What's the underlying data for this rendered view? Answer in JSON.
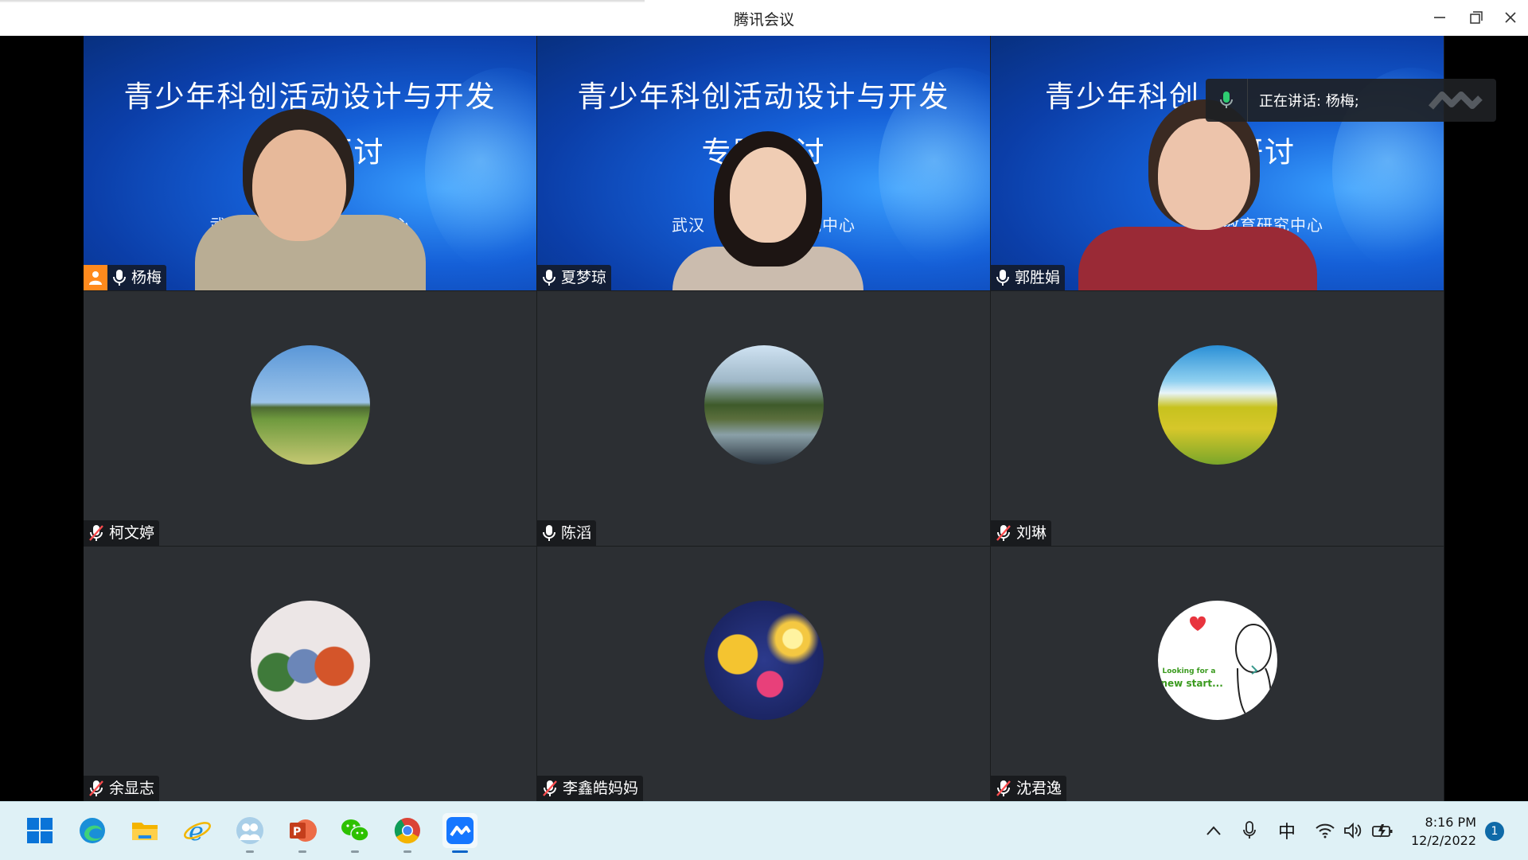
{
  "window": {
    "title": "腾讯会议"
  },
  "speaking_toast": {
    "text": "正在讲话: 杨梅;"
  },
  "slide": {
    "line1": "青少年科创活动设计与开发",
    "line2": "专题研讨",
    "line3": "武汉市科学教育研究中心"
  },
  "slides_visible": [
    {
      "line1": "青少年科创活动设计与开发",
      "line2": "研讨",
      "line3": "武汉　　　　　育研究中心"
    },
    {
      "line1": "青少年科创活动设计与开发",
      "line2": "专题研讨",
      "line3": "武汉　　　　　研究中心"
    },
    {
      "line1": "青少年科创",
      "line2": "题研讨",
      "line3": "学教育研究中心"
    }
  ],
  "participants": [
    {
      "name": "杨梅",
      "mic": "on",
      "host": true
    },
    {
      "name": "夏梦琼",
      "mic": "on"
    },
    {
      "name": "郭胜娟",
      "mic": "on"
    },
    {
      "name": "柯文婷",
      "mic": "muted"
    },
    {
      "name": "陈滔",
      "mic": "on"
    },
    {
      "name": "刘琳",
      "mic": "muted"
    },
    {
      "name": "余显志",
      "mic": "muted"
    },
    {
      "name": "李鑫皓妈妈",
      "mic": "muted"
    },
    {
      "name": "沈君逸",
      "mic": "muted"
    }
  ],
  "avatar_text": {
    "line1": "Looking for a",
    "line2": "new start..."
  },
  "taskbar": {
    "apps": [
      "start-icon",
      "edge-icon",
      "file-explorer-icon",
      "ie-icon",
      "meeting-people-icon",
      "powerpoint-icon",
      "wechat-icon",
      "chrome-icon",
      "tencent-meeting-icon"
    ],
    "ime": "中",
    "time": "8:16 PM",
    "date": "12/2/2022",
    "notifications": "1"
  },
  "colors": {
    "host": "#ff8a1d",
    "active_border": "#25c06a",
    "taskbar": "#dff1f6"
  }
}
